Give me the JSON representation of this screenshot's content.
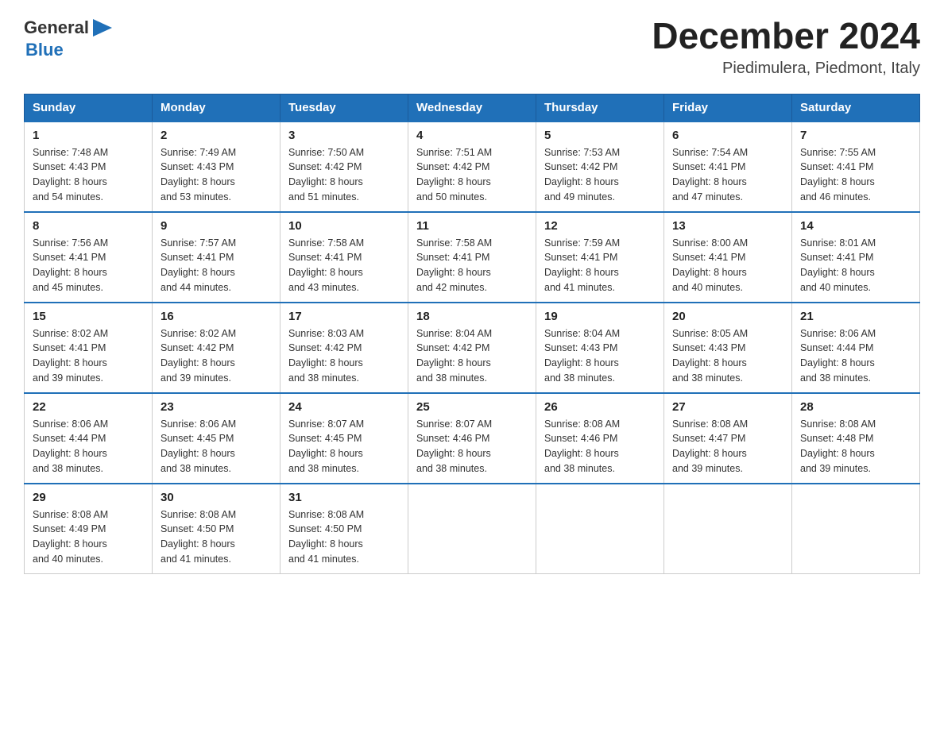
{
  "header": {
    "logo_general": "General",
    "logo_blue": "Blue",
    "month_year": "December 2024",
    "location": "Piedimulera, Piedmont, Italy"
  },
  "days_of_week": [
    "Sunday",
    "Monday",
    "Tuesday",
    "Wednesday",
    "Thursday",
    "Friday",
    "Saturday"
  ],
  "weeks": [
    [
      {
        "day": "1",
        "sunrise": "7:48 AM",
        "sunset": "4:43 PM",
        "daylight": "8 hours and 54 minutes."
      },
      {
        "day": "2",
        "sunrise": "7:49 AM",
        "sunset": "4:43 PM",
        "daylight": "8 hours and 53 minutes."
      },
      {
        "day": "3",
        "sunrise": "7:50 AM",
        "sunset": "4:42 PM",
        "daylight": "8 hours and 51 minutes."
      },
      {
        "day": "4",
        "sunrise": "7:51 AM",
        "sunset": "4:42 PM",
        "daylight": "8 hours and 50 minutes."
      },
      {
        "day": "5",
        "sunrise": "7:53 AM",
        "sunset": "4:42 PM",
        "daylight": "8 hours and 49 minutes."
      },
      {
        "day": "6",
        "sunrise": "7:54 AM",
        "sunset": "4:41 PM",
        "daylight": "8 hours and 47 minutes."
      },
      {
        "day": "7",
        "sunrise": "7:55 AM",
        "sunset": "4:41 PM",
        "daylight": "8 hours and 46 minutes."
      }
    ],
    [
      {
        "day": "8",
        "sunrise": "7:56 AM",
        "sunset": "4:41 PM",
        "daylight": "8 hours and 45 minutes."
      },
      {
        "day": "9",
        "sunrise": "7:57 AM",
        "sunset": "4:41 PM",
        "daylight": "8 hours and 44 minutes."
      },
      {
        "day": "10",
        "sunrise": "7:58 AM",
        "sunset": "4:41 PM",
        "daylight": "8 hours and 43 minutes."
      },
      {
        "day": "11",
        "sunrise": "7:58 AM",
        "sunset": "4:41 PM",
        "daylight": "8 hours and 42 minutes."
      },
      {
        "day": "12",
        "sunrise": "7:59 AM",
        "sunset": "4:41 PM",
        "daylight": "8 hours and 41 minutes."
      },
      {
        "day": "13",
        "sunrise": "8:00 AM",
        "sunset": "4:41 PM",
        "daylight": "8 hours and 40 minutes."
      },
      {
        "day": "14",
        "sunrise": "8:01 AM",
        "sunset": "4:41 PM",
        "daylight": "8 hours and 40 minutes."
      }
    ],
    [
      {
        "day": "15",
        "sunrise": "8:02 AM",
        "sunset": "4:41 PM",
        "daylight": "8 hours and 39 minutes."
      },
      {
        "day": "16",
        "sunrise": "8:02 AM",
        "sunset": "4:42 PM",
        "daylight": "8 hours and 39 minutes."
      },
      {
        "day": "17",
        "sunrise": "8:03 AM",
        "sunset": "4:42 PM",
        "daylight": "8 hours and 38 minutes."
      },
      {
        "day": "18",
        "sunrise": "8:04 AM",
        "sunset": "4:42 PM",
        "daylight": "8 hours and 38 minutes."
      },
      {
        "day": "19",
        "sunrise": "8:04 AM",
        "sunset": "4:43 PM",
        "daylight": "8 hours and 38 minutes."
      },
      {
        "day": "20",
        "sunrise": "8:05 AM",
        "sunset": "4:43 PM",
        "daylight": "8 hours and 38 minutes."
      },
      {
        "day": "21",
        "sunrise": "8:06 AM",
        "sunset": "4:44 PM",
        "daylight": "8 hours and 38 minutes."
      }
    ],
    [
      {
        "day": "22",
        "sunrise": "8:06 AM",
        "sunset": "4:44 PM",
        "daylight": "8 hours and 38 minutes."
      },
      {
        "day": "23",
        "sunrise": "8:06 AM",
        "sunset": "4:45 PM",
        "daylight": "8 hours and 38 minutes."
      },
      {
        "day": "24",
        "sunrise": "8:07 AM",
        "sunset": "4:45 PM",
        "daylight": "8 hours and 38 minutes."
      },
      {
        "day": "25",
        "sunrise": "8:07 AM",
        "sunset": "4:46 PM",
        "daylight": "8 hours and 38 minutes."
      },
      {
        "day": "26",
        "sunrise": "8:08 AM",
        "sunset": "4:46 PM",
        "daylight": "8 hours and 38 minutes."
      },
      {
        "day": "27",
        "sunrise": "8:08 AM",
        "sunset": "4:47 PM",
        "daylight": "8 hours and 39 minutes."
      },
      {
        "day": "28",
        "sunrise": "8:08 AM",
        "sunset": "4:48 PM",
        "daylight": "8 hours and 39 minutes."
      }
    ],
    [
      {
        "day": "29",
        "sunrise": "8:08 AM",
        "sunset": "4:49 PM",
        "daylight": "8 hours and 40 minutes."
      },
      {
        "day": "30",
        "sunrise": "8:08 AM",
        "sunset": "4:50 PM",
        "daylight": "8 hours and 41 minutes."
      },
      {
        "day": "31",
        "sunrise": "8:08 AM",
        "sunset": "4:50 PM",
        "daylight": "8 hours and 41 minutes."
      },
      null,
      null,
      null,
      null
    ]
  ],
  "labels": {
    "sunrise": "Sunrise:",
    "sunset": "Sunset:",
    "daylight": "Daylight:"
  }
}
